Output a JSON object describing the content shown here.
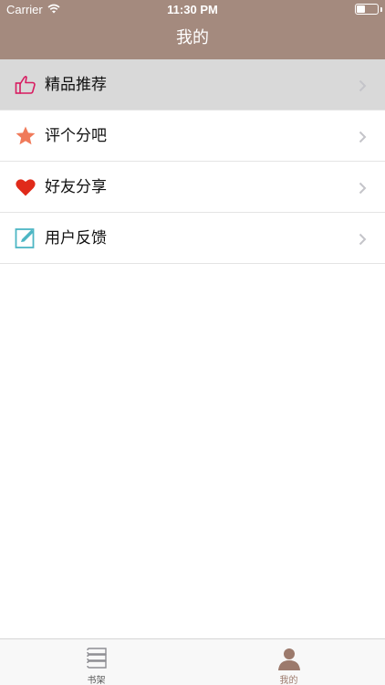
{
  "status_bar": {
    "carrier": "Carrier",
    "time": "11:30 PM"
  },
  "nav": {
    "title": "我的"
  },
  "menu": {
    "items": [
      {
        "label": "精品推荐",
        "icon": "thumbs-up-icon",
        "color": "#d81b60"
      },
      {
        "label": "评个分吧",
        "icon": "star-icon",
        "color": "#f07a5a"
      },
      {
        "label": "好友分享",
        "icon": "heart-icon",
        "color": "#e53935"
      },
      {
        "label": "用户反馈",
        "icon": "edit-icon",
        "color": "#4db6c4"
      }
    ]
  },
  "tabbar": {
    "tabs": [
      {
        "label": "书架",
        "icon": "bookshelf-icon"
      },
      {
        "label": "我的",
        "icon": "user-icon"
      }
    ]
  },
  "colors": {
    "header": "#a48a7e",
    "selected_row": "#d9d9d9",
    "active_tab": "#9c7a6c"
  }
}
